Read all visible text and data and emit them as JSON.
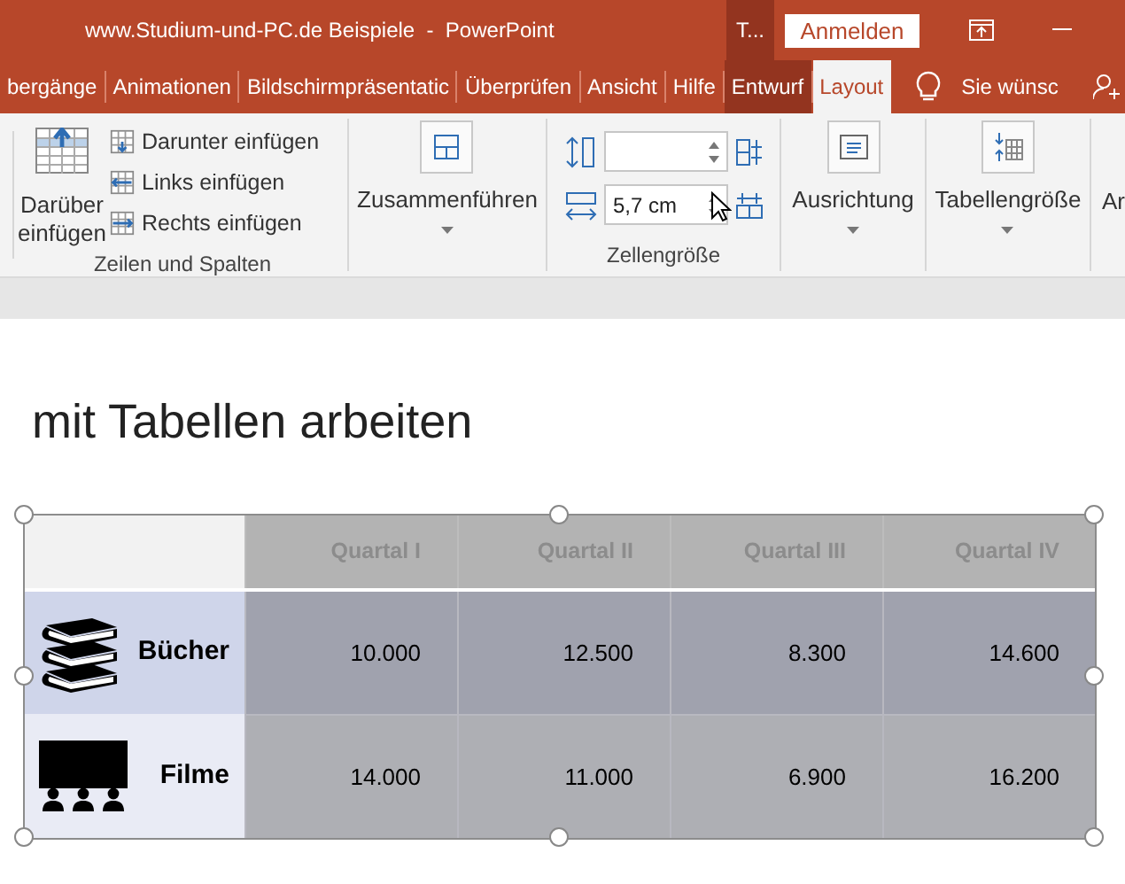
{
  "window": {
    "title": "www.Studium-und-PC.de Beispiele  -  PowerPoint",
    "context_label": "T...",
    "sign_in": "Anmelden"
  },
  "tabs": [
    {
      "label": "bergänge",
      "selected": false,
      "contextual": false
    },
    {
      "label": "Animationen",
      "selected": false,
      "contextual": false
    },
    {
      "label": "Bildschirmpräsentatic",
      "selected": false,
      "contextual": false
    },
    {
      "label": "Überprüfen",
      "selected": false,
      "contextual": false
    },
    {
      "label": "Ansicht",
      "selected": false,
      "contextual": false
    },
    {
      "label": "Hilfe",
      "selected": false,
      "contextual": false
    },
    {
      "label": "Entwurf",
      "selected": false,
      "contextual": true
    },
    {
      "label": "Layout",
      "selected": true,
      "contextual": true
    }
  ],
  "tell_me": "Sie wünsc",
  "ribbon": {
    "rows_columns": {
      "big_button": [
        "Darüber",
        "einfügen"
      ],
      "small_buttons": [
        "Darunter einfügen",
        "Links einfügen",
        "Rechts einfügen"
      ],
      "label": "Zeilen und Spalten"
    },
    "merge": {
      "label": "Zusammenführen"
    },
    "cell_size": {
      "width_value": "5,7 cm",
      "label": "Zellengröße"
    },
    "alignment": {
      "label": "Ausrichtung"
    },
    "table_size": {
      "label": "Tabellengröße"
    },
    "cut_group": {
      "label": "Ar"
    }
  },
  "slide": {
    "title": "mit Tabellen arbeiten",
    "table": {
      "columns": [
        "",
        "Quartal I",
        "Quartal II",
        "Quartal III",
        "Quartal IV"
      ],
      "rows": [
        {
          "label": "Bücher",
          "values": [
            "10.000",
            "12.500",
            "8.300",
            "14.600"
          ]
        },
        {
          "label": "Filme",
          "values": [
            "14.000",
            "11.000",
            "6.900",
            "16.200"
          ]
        }
      ]
    }
  }
}
